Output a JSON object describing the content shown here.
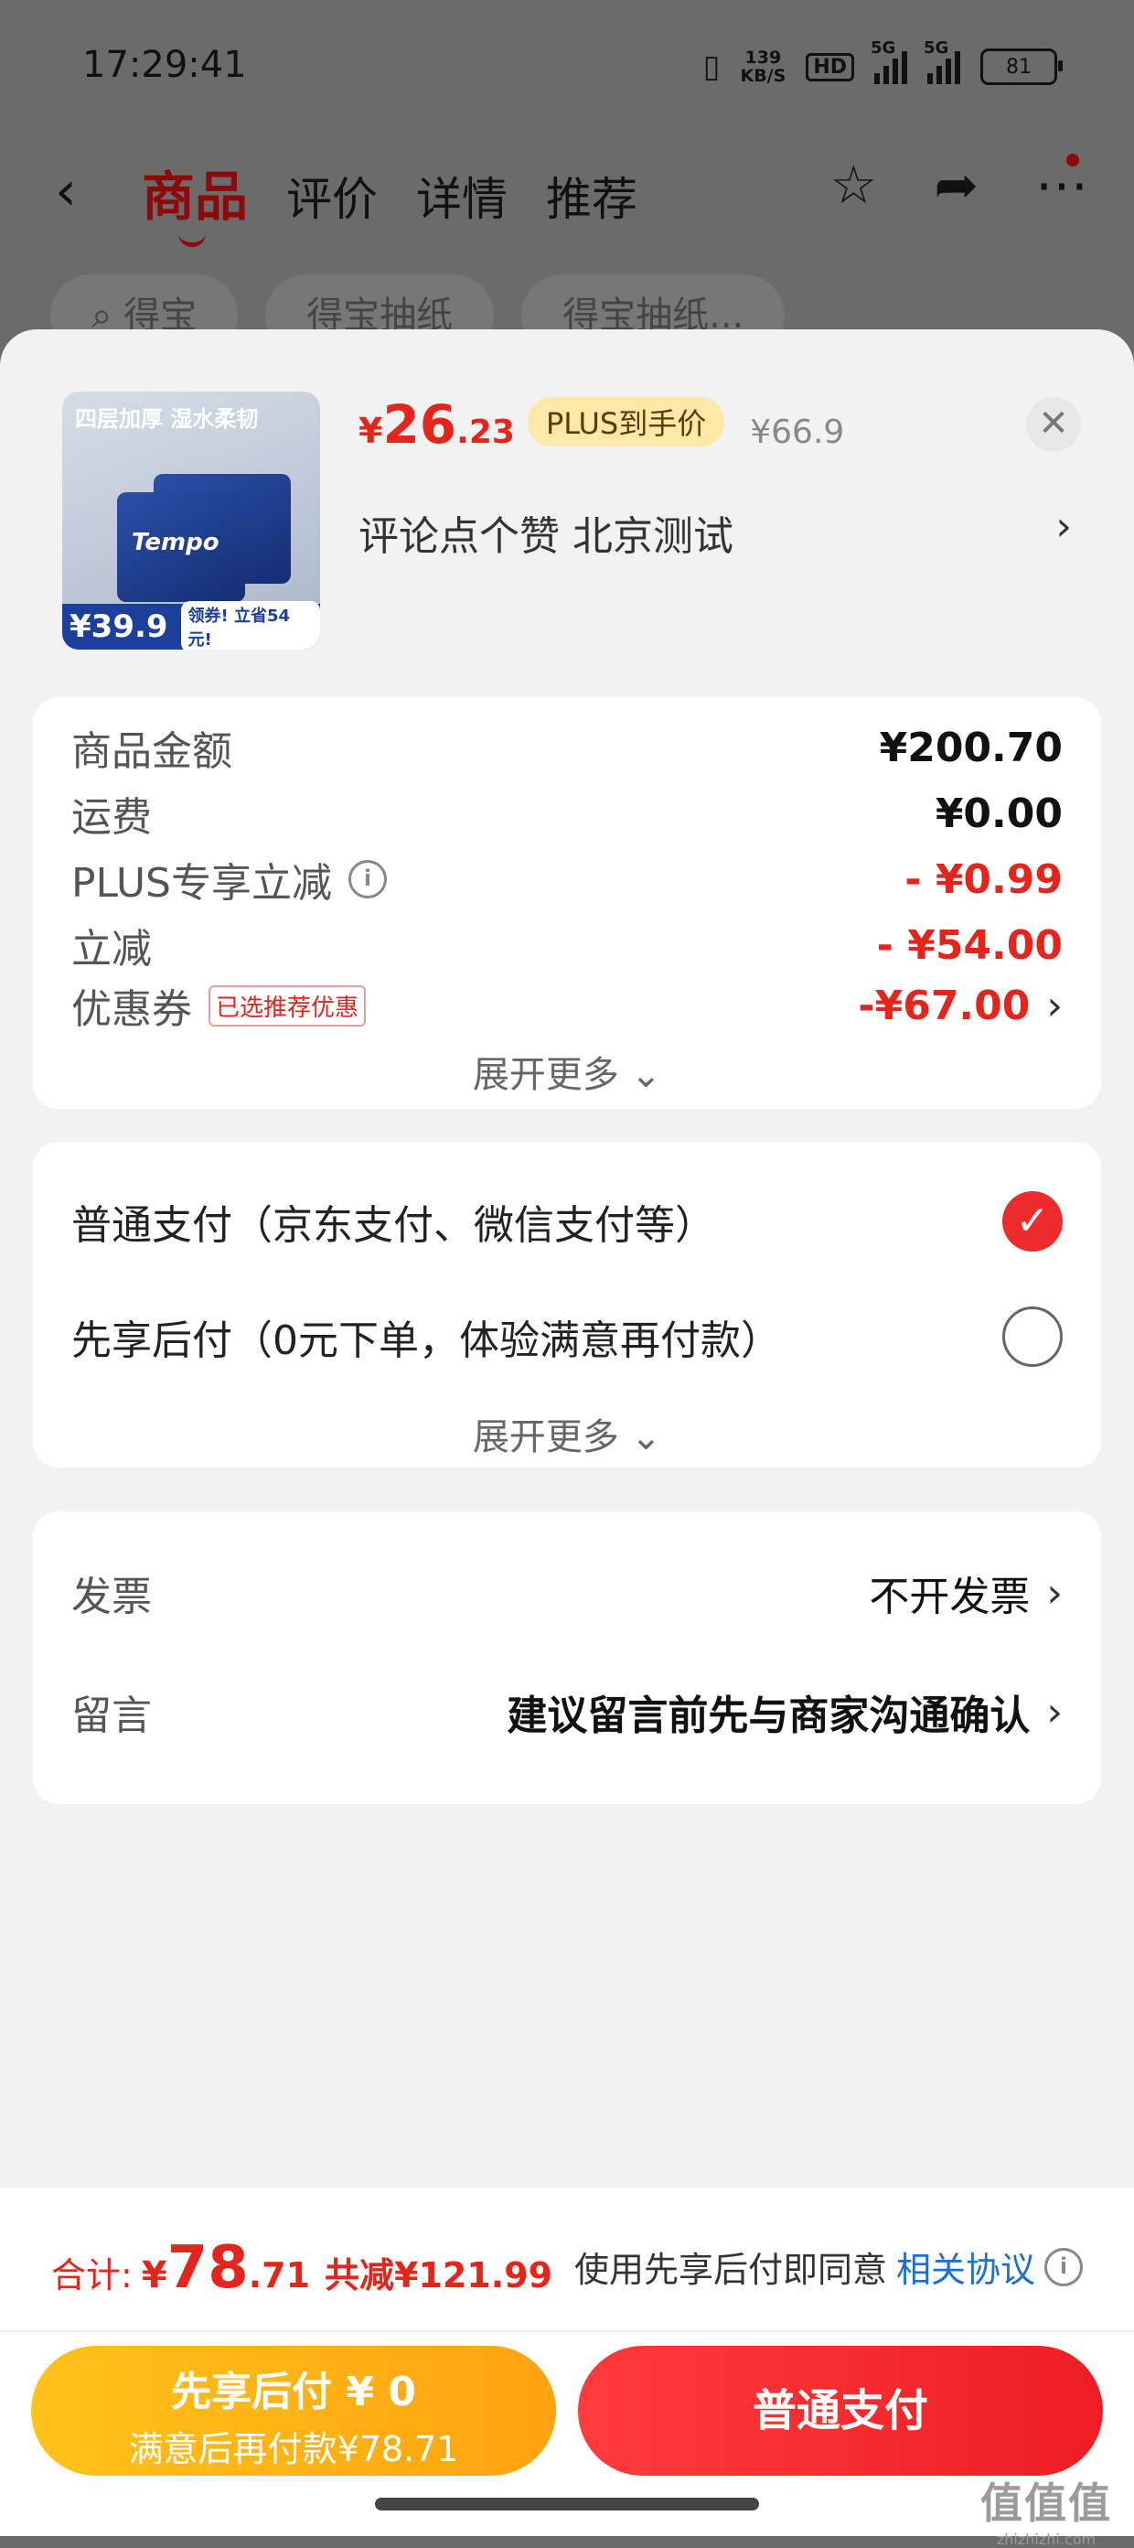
{
  "status_bar": {
    "time": "17:29:41",
    "net_speed_value": "139",
    "net_speed_unit": "KB/S",
    "hd": "HD",
    "sig1": "5G",
    "sig2": "5G",
    "battery": "81"
  },
  "nav": {
    "tabs": [
      "商品",
      "评价",
      "详情",
      "推荐"
    ],
    "active_tab": "商品",
    "search_pills": [
      "得宝",
      "得宝抽纸",
      "得宝抽纸..."
    ]
  },
  "product": {
    "thumb_top_text": "四层加厚 湿水柔韧",
    "thumb_logo": "Tempo",
    "thumb_price": "¥39.9",
    "thumb_promo": "领券! 立省54元!",
    "price_currency": "¥",
    "price_int": "26",
    "price_dec": ".23",
    "plus_tag": "PLUS到手价",
    "original_price": "¥66.9",
    "sku_text": "评论点个赞  北京测试"
  },
  "summary": {
    "rows": [
      {
        "label": "商品金额",
        "value": "¥200.70"
      },
      {
        "label": "运费",
        "value": "¥0.00"
      },
      {
        "label": "PLUS专享立减",
        "value": "- ¥0.99"
      },
      {
        "label": "立减",
        "value": "- ¥54.00"
      },
      {
        "label": "优惠券",
        "value": "-¥67.00",
        "tag": "已选推荐优惠"
      }
    ],
    "expand": "展开更多"
  },
  "payment": {
    "options": [
      {
        "label": "普通支付（京东支付、微信支付等）",
        "selected": true
      },
      {
        "label": "先享后付（0元下单，体验满意再付款）",
        "selected": false
      }
    ],
    "expand": "展开更多"
  },
  "extra": {
    "invoice_label": "发票",
    "invoice_value": "不开发票",
    "message_label": "留言",
    "message_placeholder": "建议留言前先与商家沟通确认"
  },
  "footer": {
    "total_label": "合计:",
    "total_currency": "¥",
    "total_int": "78",
    "total_dec": ".71",
    "total_saved": "共减¥121.99",
    "agree_text": "使用先享后付即同意",
    "agree_link": "相关协议",
    "btn_later_line1": "先享后付 ¥ 0",
    "btn_later_line2": "满意后再付款¥78.71",
    "btn_pay": "普通支付"
  },
  "watermark": {
    "line1": "值值值",
    "line2": "zhizhizhi.com"
  },
  "colors": {
    "accent_red": "#e5241c",
    "link_blue": "#1a6fd8",
    "yellow_button": "#ffb515"
  }
}
